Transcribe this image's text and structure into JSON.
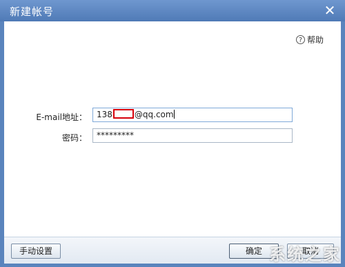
{
  "dialog": {
    "title": "新建帐号",
    "close_glyph": "✕",
    "help_label": "帮助",
    "help_glyph": "?"
  },
  "form": {
    "email_label": "E-mail地址：",
    "email_prefix": "138",
    "email_suffix": "@qq.com",
    "password_label": "密码：",
    "password_value": "*********"
  },
  "buttons": {
    "manual_settings": "手动设置",
    "ok": "确定",
    "cancel": "取消"
  },
  "watermark": "系统之家",
  "colors": {
    "titlebar": "#5a84bd",
    "redaction": "#d6000b"
  }
}
